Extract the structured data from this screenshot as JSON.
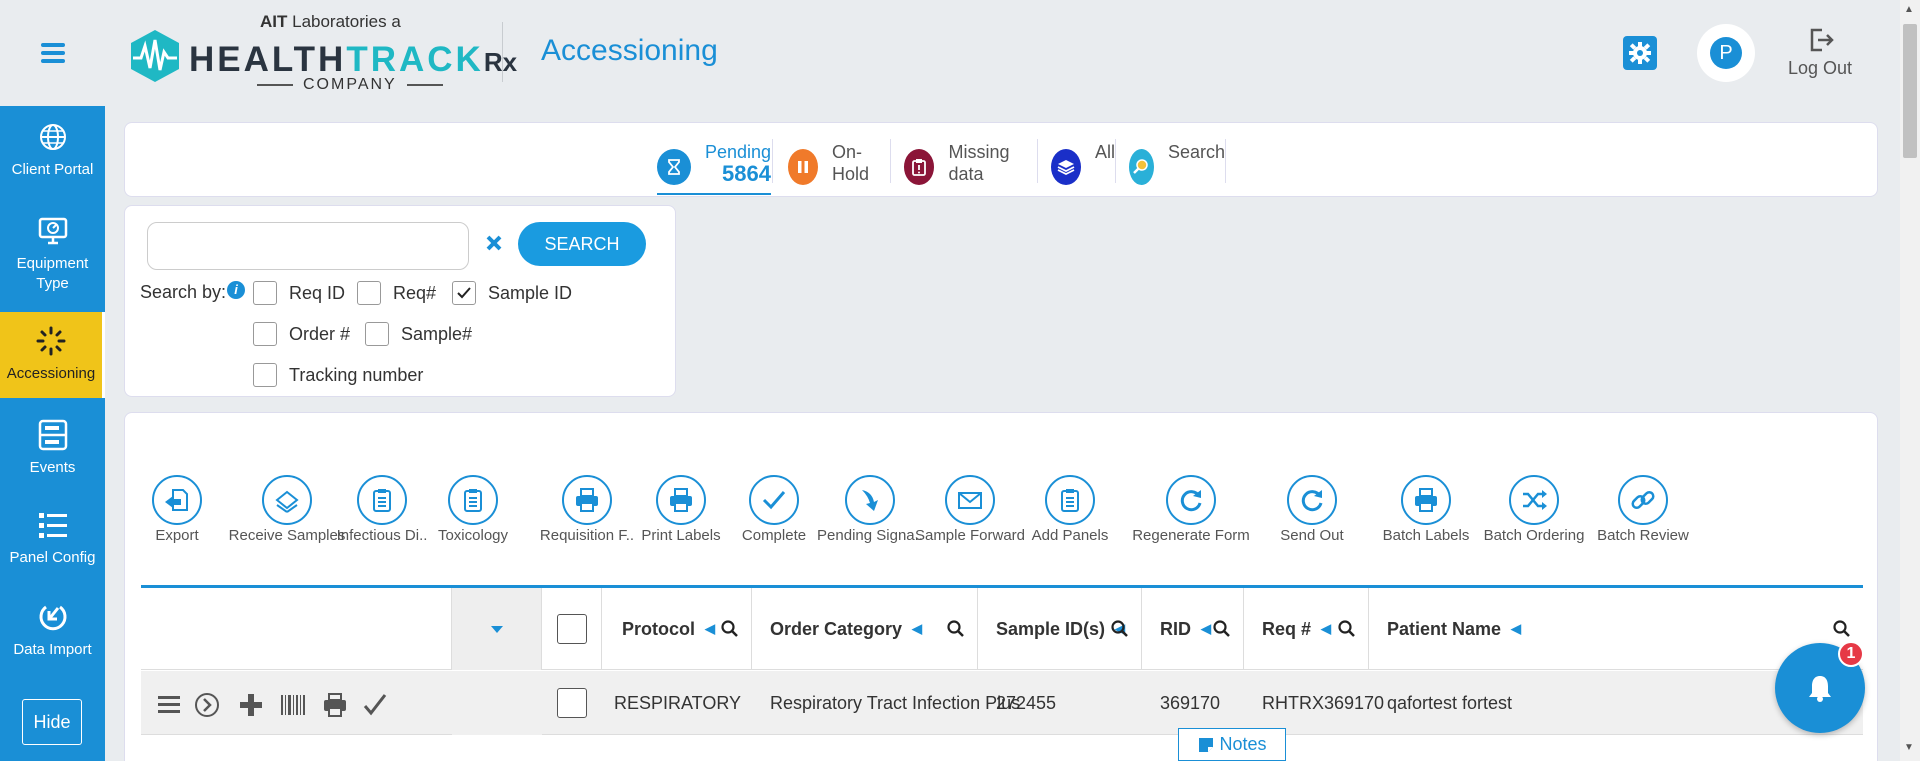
{
  "sidebar": {
    "items": [
      {
        "label": "Client Portal",
        "icon": "globe-icon"
      },
      {
        "label": "Equipment Type",
        "icon": "monitor-icon"
      },
      {
        "label": "Accessioning",
        "icon": "spinner-icon",
        "active": true
      },
      {
        "label": "Events",
        "icon": "server-icon"
      },
      {
        "label": "Panel Config",
        "icon": "list-icon"
      },
      {
        "label": "Data Import",
        "icon": "import-icon"
      }
    ],
    "hide_label": "Hide"
  },
  "header": {
    "logo_top_bold": "AIT",
    "logo_top_rest": " Laboratories a",
    "logo_word_dark": "HEALTH",
    "logo_word_teal": "TRACK",
    "logo_word_rx": "Rx",
    "logo_sub": "COMPANY",
    "page_title": "Accessioning",
    "avatar_letter": "P",
    "logout_label": "Log Out"
  },
  "status_tabs": [
    {
      "label": "Pending",
      "count": "5864",
      "icon": "hourglass-icon",
      "color": "#1a8fd6"
    },
    {
      "label": "On-Hold",
      "icon": "pause-icon",
      "color": "#f07a2a"
    },
    {
      "label": "Missing data",
      "icon": "clipboard-icon",
      "color": "#8b1538"
    },
    {
      "label": "All",
      "icon": "layers-icon",
      "color": "#1a2fc8"
    },
    {
      "label": "Search",
      "icon": "magnifier-icon",
      "color": "#2ab0d8"
    }
  ],
  "search": {
    "placeholder": "",
    "button_label": "SEARCH",
    "search_by_label": "Search by:",
    "options": [
      {
        "label": "Req ID",
        "checked": false
      },
      {
        "label": "Req#",
        "checked": false
      },
      {
        "label": "Sample ID",
        "checked": true
      },
      {
        "label": "Order #",
        "checked": false
      },
      {
        "label": "Sample#",
        "checked": false
      },
      {
        "label": "Tracking number",
        "checked": false
      }
    ]
  },
  "toolbar": [
    {
      "label": "Export",
      "icon": "export-icon"
    },
    {
      "label": "Receive Samples",
      "icon": "receive-icon"
    },
    {
      "label": "Infectious Di..",
      "icon": "clipboard-icon"
    },
    {
      "label": "Toxicology",
      "icon": "clipboard-icon"
    },
    {
      "label": "Requisition F..",
      "icon": "printer-icon"
    },
    {
      "label": "Print Labels",
      "icon": "printer-icon"
    },
    {
      "label": "Complete",
      "icon": "check-icon"
    },
    {
      "label": "Pending Signa..",
      "icon": "down-arrow-icon"
    },
    {
      "label": "Sample Forward",
      "icon": "envelope-icon"
    },
    {
      "label": "Add Panels",
      "icon": "clipboard-icon"
    },
    {
      "label": "Regenerate Form",
      "icon": "refresh-icon"
    },
    {
      "label": "Send Out",
      "icon": "refresh-icon"
    },
    {
      "label": "Batch Labels",
      "icon": "printer-icon"
    },
    {
      "label": "Batch Ordering",
      "icon": "shuffle-icon"
    },
    {
      "label": "Batch Review",
      "icon": "link-icon"
    }
  ],
  "grid": {
    "columns": [
      "Protocol",
      "Order Category",
      "Sample ID(s)",
      "RID",
      "Req #",
      "Patient Name"
    ],
    "rows": [
      {
        "protocol": "RESPIRATORY",
        "order_category": "Respiratory Tract Infection Plus",
        "sample_id": "272455",
        "rid": "369170",
        "req": "RHTRX369170",
        "patient": "qafortest fortest"
      }
    ]
  },
  "notes_label": "Notes",
  "notification_count": "1"
}
